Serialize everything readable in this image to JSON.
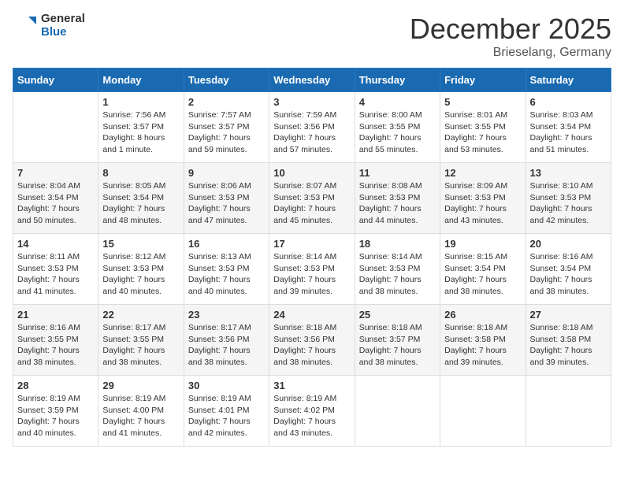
{
  "header": {
    "logo_general": "General",
    "logo_blue": "Blue",
    "month_title": "December 2025",
    "location": "Brieselang, Germany"
  },
  "days_of_week": [
    "Sunday",
    "Monday",
    "Tuesday",
    "Wednesday",
    "Thursday",
    "Friday",
    "Saturday"
  ],
  "weeks": [
    [
      {
        "day": "",
        "info": ""
      },
      {
        "day": "1",
        "info": "Sunrise: 7:56 AM\nSunset: 3:57 PM\nDaylight: 8 hours\nand 1 minute."
      },
      {
        "day": "2",
        "info": "Sunrise: 7:57 AM\nSunset: 3:57 PM\nDaylight: 7 hours\nand 59 minutes."
      },
      {
        "day": "3",
        "info": "Sunrise: 7:59 AM\nSunset: 3:56 PM\nDaylight: 7 hours\nand 57 minutes."
      },
      {
        "day": "4",
        "info": "Sunrise: 8:00 AM\nSunset: 3:55 PM\nDaylight: 7 hours\nand 55 minutes."
      },
      {
        "day": "5",
        "info": "Sunrise: 8:01 AM\nSunset: 3:55 PM\nDaylight: 7 hours\nand 53 minutes."
      },
      {
        "day": "6",
        "info": "Sunrise: 8:03 AM\nSunset: 3:54 PM\nDaylight: 7 hours\nand 51 minutes."
      }
    ],
    [
      {
        "day": "7",
        "info": "Sunrise: 8:04 AM\nSunset: 3:54 PM\nDaylight: 7 hours\nand 50 minutes."
      },
      {
        "day": "8",
        "info": "Sunrise: 8:05 AM\nSunset: 3:54 PM\nDaylight: 7 hours\nand 48 minutes."
      },
      {
        "day": "9",
        "info": "Sunrise: 8:06 AM\nSunset: 3:53 PM\nDaylight: 7 hours\nand 47 minutes."
      },
      {
        "day": "10",
        "info": "Sunrise: 8:07 AM\nSunset: 3:53 PM\nDaylight: 7 hours\nand 45 minutes."
      },
      {
        "day": "11",
        "info": "Sunrise: 8:08 AM\nSunset: 3:53 PM\nDaylight: 7 hours\nand 44 minutes."
      },
      {
        "day": "12",
        "info": "Sunrise: 8:09 AM\nSunset: 3:53 PM\nDaylight: 7 hours\nand 43 minutes."
      },
      {
        "day": "13",
        "info": "Sunrise: 8:10 AM\nSunset: 3:53 PM\nDaylight: 7 hours\nand 42 minutes."
      }
    ],
    [
      {
        "day": "14",
        "info": "Sunrise: 8:11 AM\nSunset: 3:53 PM\nDaylight: 7 hours\nand 41 minutes."
      },
      {
        "day": "15",
        "info": "Sunrise: 8:12 AM\nSunset: 3:53 PM\nDaylight: 7 hours\nand 40 minutes."
      },
      {
        "day": "16",
        "info": "Sunrise: 8:13 AM\nSunset: 3:53 PM\nDaylight: 7 hours\nand 40 minutes."
      },
      {
        "day": "17",
        "info": "Sunrise: 8:14 AM\nSunset: 3:53 PM\nDaylight: 7 hours\nand 39 minutes."
      },
      {
        "day": "18",
        "info": "Sunrise: 8:14 AM\nSunset: 3:53 PM\nDaylight: 7 hours\nand 38 minutes."
      },
      {
        "day": "19",
        "info": "Sunrise: 8:15 AM\nSunset: 3:54 PM\nDaylight: 7 hours\nand 38 minutes."
      },
      {
        "day": "20",
        "info": "Sunrise: 8:16 AM\nSunset: 3:54 PM\nDaylight: 7 hours\nand 38 minutes."
      }
    ],
    [
      {
        "day": "21",
        "info": "Sunrise: 8:16 AM\nSunset: 3:55 PM\nDaylight: 7 hours\nand 38 minutes."
      },
      {
        "day": "22",
        "info": "Sunrise: 8:17 AM\nSunset: 3:55 PM\nDaylight: 7 hours\nand 38 minutes."
      },
      {
        "day": "23",
        "info": "Sunrise: 8:17 AM\nSunset: 3:56 PM\nDaylight: 7 hours\nand 38 minutes."
      },
      {
        "day": "24",
        "info": "Sunrise: 8:18 AM\nSunset: 3:56 PM\nDaylight: 7 hours\nand 38 minutes."
      },
      {
        "day": "25",
        "info": "Sunrise: 8:18 AM\nSunset: 3:57 PM\nDaylight: 7 hours\nand 38 minutes."
      },
      {
        "day": "26",
        "info": "Sunrise: 8:18 AM\nSunset: 3:58 PM\nDaylight: 7 hours\nand 39 minutes."
      },
      {
        "day": "27",
        "info": "Sunrise: 8:18 AM\nSunset: 3:58 PM\nDaylight: 7 hours\nand 39 minutes."
      }
    ],
    [
      {
        "day": "28",
        "info": "Sunrise: 8:19 AM\nSunset: 3:59 PM\nDaylight: 7 hours\nand 40 minutes."
      },
      {
        "day": "29",
        "info": "Sunrise: 8:19 AM\nSunset: 4:00 PM\nDaylight: 7 hours\nand 41 minutes."
      },
      {
        "day": "30",
        "info": "Sunrise: 8:19 AM\nSunset: 4:01 PM\nDaylight: 7 hours\nand 42 minutes."
      },
      {
        "day": "31",
        "info": "Sunrise: 8:19 AM\nSunset: 4:02 PM\nDaylight: 7 hours\nand 43 minutes."
      },
      {
        "day": "",
        "info": ""
      },
      {
        "day": "",
        "info": ""
      },
      {
        "day": "",
        "info": ""
      }
    ]
  ]
}
